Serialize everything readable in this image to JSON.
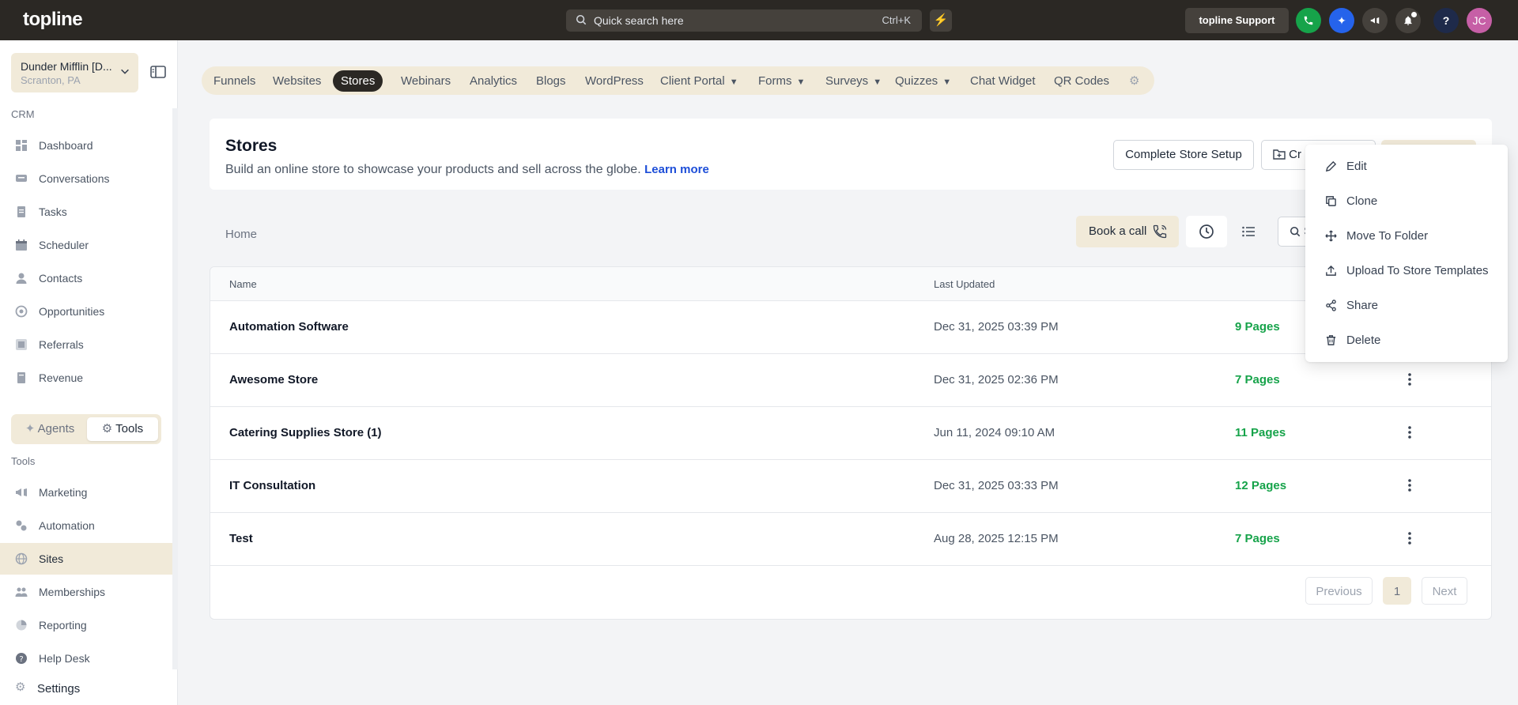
{
  "topbar": {
    "logo": "topline",
    "search_placeholder": "Quick search here",
    "search_shortcut": "Ctrl+K",
    "support_label": "topline Support",
    "avatar_initials": "JC",
    "colors": {
      "bg": "#2b2824",
      "phone": "#16a34a",
      "ai": "#2563eb",
      "avatar": "#c65fa6"
    }
  },
  "sidebar": {
    "account_name": "Dunder Mifflin [D...",
    "account_location": "Scranton, PA",
    "crm_label": "CRM",
    "crm_items": [
      {
        "label": "Dashboard",
        "icon": "dashboard-icon"
      },
      {
        "label": "Conversations",
        "icon": "conversations-icon"
      },
      {
        "label": "Tasks",
        "icon": "tasks-icon"
      },
      {
        "label": "Scheduler",
        "icon": "calendar-icon"
      },
      {
        "label": "Contacts",
        "icon": "contacts-icon"
      },
      {
        "label": "Opportunities",
        "icon": "opportunities-icon"
      },
      {
        "label": "Referrals",
        "icon": "referrals-icon"
      },
      {
        "label": "Revenue",
        "icon": "revenue-icon"
      }
    ],
    "toggle": {
      "agents": "Agents",
      "tools": "Tools",
      "active": "tools"
    },
    "tools_label": "Tools",
    "tools_items": [
      {
        "label": "Marketing",
        "icon": "megaphone-icon"
      },
      {
        "label": "Automation",
        "icon": "automation-icon"
      },
      {
        "label": "Sites",
        "icon": "globe-icon",
        "active": true
      },
      {
        "label": "Memberships",
        "icon": "memberships-icon"
      },
      {
        "label": "Reporting",
        "icon": "reporting-icon"
      },
      {
        "label": "Help Desk",
        "icon": "help-desk-icon"
      }
    ],
    "settings_label": "Settings"
  },
  "tabs": [
    {
      "label": "Funnels"
    },
    {
      "label": "Websites"
    },
    {
      "label": "Stores",
      "active": true
    },
    {
      "label": "Webinars"
    },
    {
      "label": "Analytics"
    },
    {
      "label": "Blogs"
    },
    {
      "label": "WordPress"
    },
    {
      "label": "Client Portal",
      "dropdown": true
    },
    {
      "label": "Forms",
      "dropdown": true
    },
    {
      "label": "Surveys",
      "dropdown": true
    },
    {
      "label": "Quizzes",
      "dropdown": true
    },
    {
      "label": "Chat Widget"
    },
    {
      "label": "QR Codes"
    }
  ],
  "header": {
    "title": "Stores",
    "description": "Build an online store to showcase your products and sell across the globe.",
    "learn_more": "Learn more",
    "complete_setup": "Complete Store Setup",
    "create_folder": "Cr"
  },
  "toolbar": {
    "breadcrumb": "Home",
    "book_call": "Book a call",
    "search_partial": "S"
  },
  "table": {
    "columns": [
      "Name",
      "Last Updated"
    ],
    "rows": [
      {
        "name": "Automation Software",
        "updated": "Dec 31, 2025 03:39 PM",
        "pages": "9 Pages"
      },
      {
        "name": "Awesome Store",
        "updated": "Dec 31, 2025 02:36 PM",
        "pages": "7 Pages"
      },
      {
        "name": "Catering Supplies Store (1)",
        "updated": "Jun 11, 2024 09:10 AM",
        "pages": "11 Pages"
      },
      {
        "name": "IT Consultation",
        "updated": "Dec 31, 2025 03:33 PM",
        "pages": "12 Pages"
      },
      {
        "name": "Test",
        "updated": "Aug 28, 2025 12:15 PM",
        "pages": "7 Pages"
      }
    ]
  },
  "pagination": {
    "previous": "Previous",
    "current": "1",
    "next": "Next"
  },
  "dropdown": {
    "items": [
      {
        "label": "Edit",
        "icon": "pencil-icon"
      },
      {
        "label": "Clone",
        "icon": "copy-icon"
      },
      {
        "label": "Move To Folder",
        "icon": "move-icon"
      },
      {
        "label": "Upload To Store Templates",
        "icon": "upload-icon"
      },
      {
        "label": "Share",
        "icon": "share-icon"
      },
      {
        "label": "Delete",
        "icon": "trash-icon"
      }
    ]
  }
}
